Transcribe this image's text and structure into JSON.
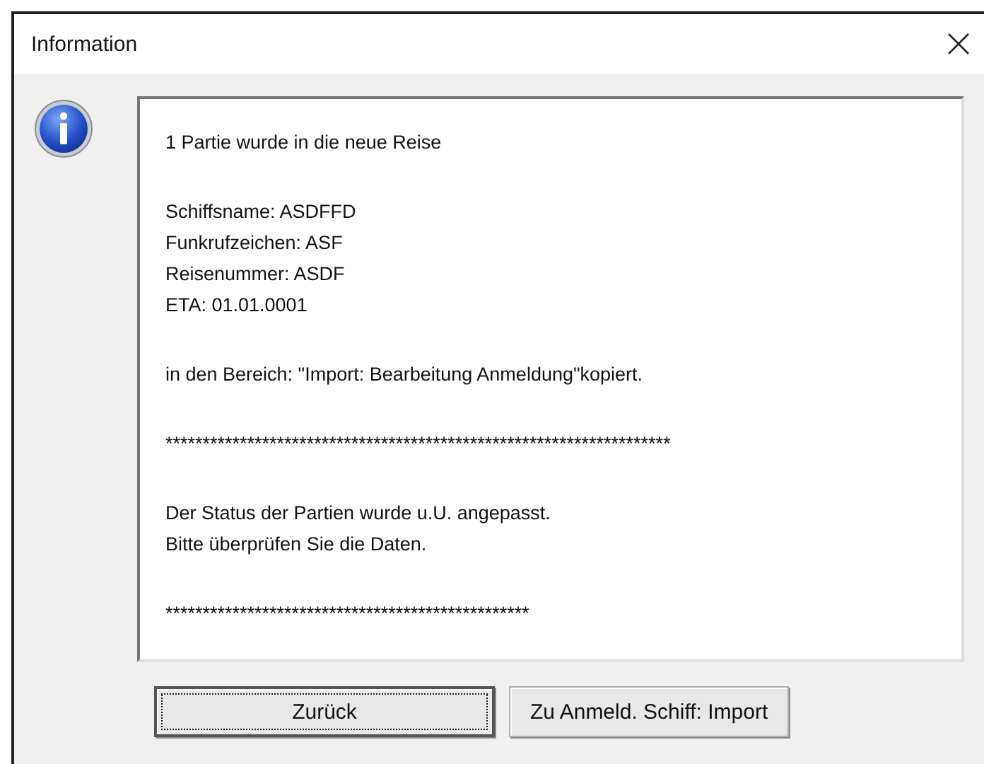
{
  "window": {
    "title": "Information"
  },
  "message": {
    "paragraphs": [
      {
        "lines": [
          "1 Partie wurde in die neue Reise"
        ]
      },
      {
        "lines": [
          "Schiffsname: ASDFFD",
          "Funkrufzeichen: ASF",
          "Reisenummer: ASDF",
          "ETA: 01.01.0001"
        ]
      },
      {
        "lines": [
          "in den Bereich: \"Import: Bearbeitung Anmeldung\"kopiert."
        ]
      },
      {
        "lines": [
          "********************************************************************"
        ]
      },
      {
        "lines": [
          "Der Status der Partien wurde u.U. angepasst.",
          "Bitte überprüfen Sie die Daten."
        ]
      },
      {
        "lines": [
          "*************************************************"
        ]
      }
    ]
  },
  "buttons": [
    {
      "label": "Zurück",
      "default": true
    },
    {
      "label": "Zu Anmeld. Schiff: Import",
      "default": false
    }
  ]
}
